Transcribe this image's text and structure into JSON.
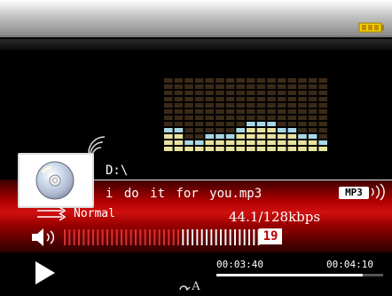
{
  "status": {
    "battery": "full"
  },
  "track": {
    "path": "D:\\",
    "title": "i do it for you.mp3",
    "format_badge": "MP3",
    "play_mode": "Normal",
    "bitrate": "44.1/128kbps"
  },
  "volume": {
    "level": 19,
    "max": 32,
    "label": "19"
  },
  "playback": {
    "state": "paused",
    "ab_label": "A",
    "elapsed": "00:03:40",
    "total": "00:04:10",
    "progress": 0.88
  },
  "equalizer": {
    "levels": [
      4,
      4,
      2,
      2,
      3,
      3,
      3,
      4,
      5,
      5,
      5,
      4,
      4,
      3,
      3,
      2
    ]
  },
  "colors": {
    "accent": "#c40000",
    "eq_top": "#a8d8e8",
    "eq_bottom": "#e8e2a0"
  },
  "icons": {
    "battery": "battery-icon",
    "cd": "cd-icon",
    "repeat": "repeat-icon",
    "speaker": "speaker-icon",
    "play": "play-icon",
    "ab": "ab-repeat-icon"
  }
}
